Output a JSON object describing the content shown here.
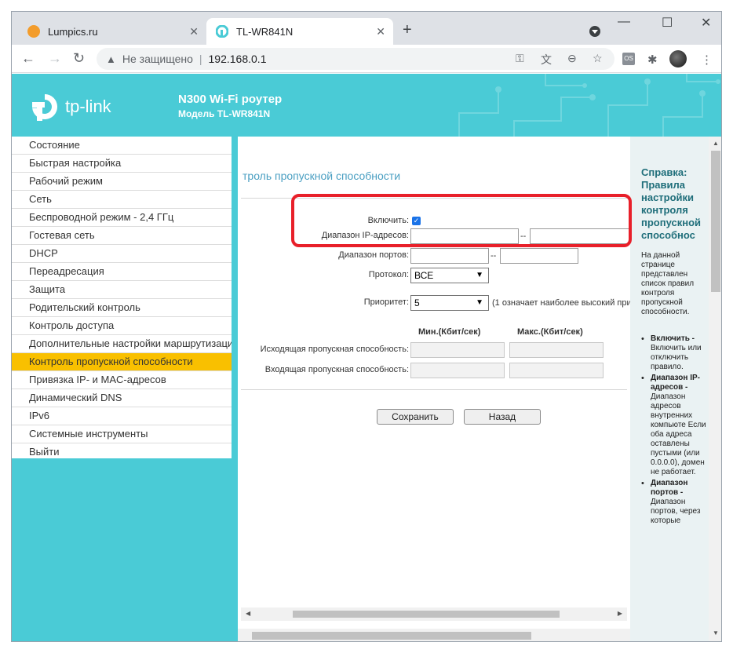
{
  "browser": {
    "tabs": [
      {
        "title": "Lumpics.ru"
      },
      {
        "title": "TL-WR841N"
      }
    ],
    "new_tab": "+",
    "window_controls": {
      "minimize": "—",
      "maximize": "☐",
      "close": "✕"
    },
    "address": {
      "security_label": "Не защищено",
      "url": "192.168.0.1"
    }
  },
  "router": {
    "logo_text": "tp-link",
    "title": "N300 Wi-Fi роутер",
    "model": "Модель TL-WR841N",
    "brand_color": "#4acbd6"
  },
  "sidebar": {
    "items": [
      {
        "label": "Состояние"
      },
      {
        "label": "Быстрая настройка"
      },
      {
        "label": "Рабочий режим"
      },
      {
        "label": "Сеть"
      },
      {
        "label": "Беспроводной режим - 2,4 ГГц"
      },
      {
        "label": "Гостевая сеть"
      },
      {
        "label": "DHCP"
      },
      {
        "label": "Переадресация"
      },
      {
        "label": "Защита"
      },
      {
        "label": "Родительский контроль"
      },
      {
        "label": "Контроль доступа"
      },
      {
        "label": "Дополнительные настройки маршрутизации"
      },
      {
        "label": "Контроль пропускной способности",
        "active": true
      },
      {
        "label": "Привязка IP- и MAC-адресов"
      },
      {
        "label": "Динамический DNS"
      },
      {
        "label": "IPv6"
      },
      {
        "label": "Системные инструменты"
      },
      {
        "label": "Выйти"
      }
    ],
    "active_color": "#f9c000"
  },
  "form": {
    "page_title": "троль пропускной способности",
    "enable_label": "Включить:",
    "enable_checked": true,
    "ip_range_label": "Диапазон IP-адресов:",
    "port_range_label": "Диапазон портов:",
    "range_sep": "--",
    "protocol_label": "Протокол:",
    "protocol_value": "ВСЕ",
    "priority_label": "Приоритет:",
    "priority_value": "5",
    "priority_note": "(1 означает наиболее высокий при",
    "min_header": "Мин.(Кбит/сек)",
    "max_header": "Макс.(Кбит/сек)",
    "egress_label": "Исходящая пропускная способность:",
    "ingress_label": "Входящая пропускная способность:",
    "save_button": "Сохранить",
    "back_button": "Назад",
    "highlight_color": "#e8202a"
  },
  "help": {
    "title": "Справка: Правила настройки контроля пропускной способнос",
    "intro": "На данной странице представлен список правил контроля пропускной способности.",
    "items": [
      {
        "term": "Включить -",
        "desc": "Включить или отключить правило."
      },
      {
        "term": "Диапазон IP-адресов -",
        "desc": "Диапазон адресов внутренних компьюте Если оба адреса оставлены пустыми (или 0.0.0.0), домен не работает."
      },
      {
        "term": "Диапазон портов -",
        "desc": "Диапазон портов, через которые"
      }
    ]
  }
}
